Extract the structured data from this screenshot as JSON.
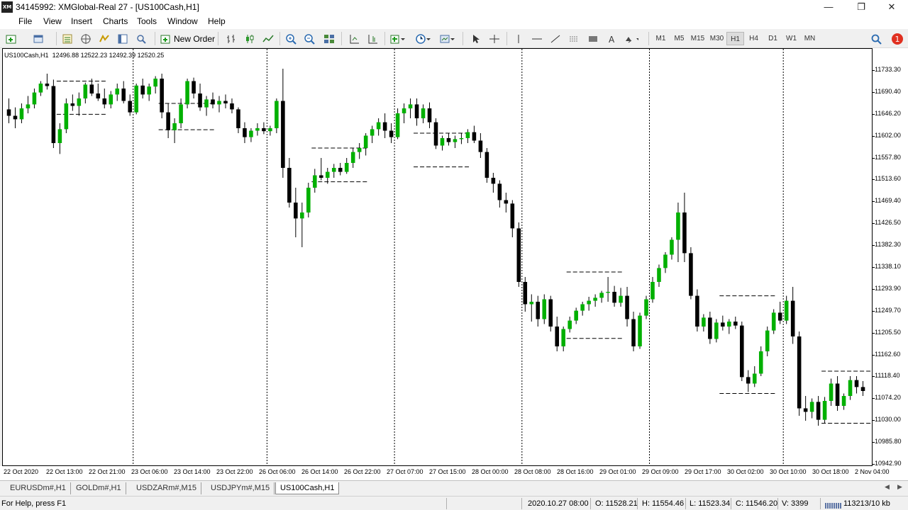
{
  "window": {
    "app_icon_text": "XM",
    "title": "34145992: XMGlobal-Real 27 - [US100Cash,H1]",
    "minimize_icon": "minimize-icon",
    "restore_icon": "restore-icon",
    "close_icon": "close-icon"
  },
  "menu": {
    "items": [
      "File",
      "View",
      "Insert",
      "Charts",
      "Tools",
      "Window",
      "Help"
    ]
  },
  "toolbar": {
    "new_order_label": "New Order",
    "timeframes": [
      "M1",
      "M5",
      "M15",
      "M30",
      "H1",
      "H4",
      "D1",
      "W1",
      "MN"
    ],
    "active_timeframe": "H1",
    "notification_count": "1",
    "icons": [
      "new-chart-icon",
      "profiles-icon",
      "market-watch-icon",
      "navigator-icon",
      "data-window-icon",
      "terminal-icon",
      "strategy-tester-icon",
      "new-order-icon",
      "bar-chart-icon",
      "candlestick-icon",
      "line-chart-icon",
      "zoom-in-icon",
      "zoom-out-icon",
      "tile-windows-icon",
      "autoscroll-icon",
      "chart-shift-icon",
      "indicators-icon",
      "periods-icon",
      "templates-icon",
      "cursor-icon",
      "crosshair-icon",
      "vertical-line-icon",
      "horizontal-line-icon",
      "trendline-icon",
      "channel-icon",
      "rectangle-icon",
      "text-icon",
      "arrows-icon",
      "search-icon",
      "notifications-icon"
    ]
  },
  "chart_header": {
    "symbol": "US100Cash,H1",
    "ohlc": "12496.88 12522.23 12492.39 12520.25"
  },
  "chart_data": {
    "type": "candlestick",
    "symbol": "US100Cash",
    "timeframe": "H1",
    "price_ticks": [
      "11733.30",
      "11690.40",
      "11646.20",
      "11602.00",
      "11557.80",
      "11513.60",
      "11469.40",
      "11426.50",
      "11382.30",
      "11338.10",
      "11293.90",
      "11249.70",
      "11205.50",
      "11162.60",
      "11118.40",
      "11074.20",
      "11030.00",
      "10985.80",
      "10942.90"
    ],
    "time_ticks": [
      "22 Oct 2020",
      "22 Oct 13:00",
      "22 Oct 21:00",
      "23 Oct 06:00",
      "23 Oct 14:00",
      "23 Oct 22:00",
      "26 Oct 06:00",
      "26 Oct 14:00",
      "26 Oct 22:00",
      "27 Oct 07:00",
      "27 Oct 15:00",
      "28 Oct 00:00",
      "28 Oct 08:00",
      "28 Oct 16:00",
      "29 Oct 01:00",
      "29 Oct 09:00",
      "29 Oct 17:00",
      "30 Oct 02:00",
      "30 Oct 10:00",
      "30 Oct 18:00",
      "2 Nov 04:00"
    ],
    "ylim": [
      10920,
      11760
    ],
    "grid": "vertical dotted day separators",
    "candle_up_color": "#00b000",
    "candle_down_color": "#000000",
    "candles": [
      [
        11638,
        11660,
        11610,
        11625
      ],
      [
        11625,
        11642,
        11600,
        11618
      ],
      [
        11618,
        11650,
        11610,
        11640
      ],
      [
        11640,
        11665,
        11630,
        11648
      ],
      [
        11648,
        11680,
        11640,
        11672
      ],
      [
        11672,
        11695,
        11665,
        11690
      ],
      [
        11690,
        11710,
        11678,
        11685
      ],
      [
        11685,
        11698,
        11560,
        11570
      ],
      [
        11570,
        11610,
        11548,
        11598
      ],
      [
        11598,
        11660,
        11590,
        11650
      ],
      [
        11650,
        11668,
        11635,
        11645
      ],
      [
        11645,
        11672,
        11625,
        11660
      ],
      [
        11660,
        11692,
        11650,
        11688
      ],
      [
        11688,
        11700,
        11665,
        11670
      ],
      [
        11670,
        11690,
        11655,
        11660
      ],
      [
        11660,
        11680,
        11640,
        11648
      ],
      [
        11648,
        11675,
        11640,
        11668
      ],
      [
        11668,
        11690,
        11655,
        11680
      ],
      [
        11680,
        11695,
        11650,
        11655
      ],
      [
        11655,
        11668,
        11625,
        11632
      ],
      [
        11632,
        11690,
        11628,
        11686
      ],
      [
        11686,
        11700,
        11660,
        11668
      ],
      [
        11668,
        11690,
        11655,
        11684
      ],
      [
        11684,
        11705,
        11670,
        11700
      ],
      [
        11700,
        11710,
        11620,
        11632
      ],
      [
        11632,
        11650,
        11580,
        11596
      ],
      [
        11596,
        11620,
        11570,
        11610
      ],
      [
        11610,
        11660,
        11600,
        11648
      ],
      [
        11648,
        11700,
        11640,
        11695
      ],
      [
        11695,
        11702,
        11660,
        11670
      ],
      [
        11670,
        11690,
        11635,
        11642
      ],
      [
        11642,
        11665,
        11625,
        11658
      ],
      [
        11658,
        11672,
        11640,
        11648
      ],
      [
        11648,
        11665,
        11632,
        11655
      ],
      [
        11655,
        11668,
        11640,
        11650
      ],
      [
        11650,
        11660,
        11630,
        11638
      ],
      [
        11638,
        11642,
        11590,
        11600
      ],
      [
        11600,
        11612,
        11570,
        11582
      ],
      [
        11582,
        11600,
        11572,
        11595
      ],
      [
        11595,
        11610,
        11585,
        11600
      ],
      [
        11600,
        11612,
        11588,
        11594
      ],
      [
        11594,
        11605,
        11585,
        11600
      ],
      [
        11600,
        11660,
        11590,
        11655
      ],
      [
        11655,
        11720,
        11500,
        11520
      ],
      [
        11520,
        11540,
        11440,
        11450
      ],
      [
        11450,
        11480,
        11380,
        11418
      ],
      [
        11418,
        11450,
        11360,
        11430
      ],
      [
        11430,
        11490,
        11420,
        11480
      ],
      [
        11480,
        11518,
        11470,
        11505
      ],
      [
        11505,
        11540,
        11495,
        11500
      ],
      [
        11500,
        11520,
        11488,
        11512
      ],
      [
        11512,
        11528,
        11500,
        11520
      ],
      [
        11520,
        11530,
        11505,
        11512
      ],
      [
        11512,
        11540,
        11508,
        11530
      ],
      [
        11530,
        11560,
        11520,
        11552
      ],
      [
        11552,
        11570,
        11538,
        11560
      ],
      [
        11560,
        11590,
        11545,
        11585
      ],
      [
        11585,
        11605,
        11570,
        11598
      ],
      [
        11598,
        11620,
        11585,
        11612
      ],
      [
        11612,
        11630,
        11580,
        11595
      ],
      [
        11595,
        11610,
        11570,
        11582
      ],
      [
        11582,
        11640,
        11578,
        11630
      ],
      [
        11630,
        11650,
        11610,
        11640
      ],
      [
        11640,
        11660,
        11620,
        11648
      ],
      [
        11648,
        11660,
        11605,
        11620
      ],
      [
        11620,
        11648,
        11610,
        11640
      ],
      [
        11640,
        11652,
        11600,
        11612
      ],
      [
        11612,
        11620,
        11558,
        11565
      ],
      [
        11565,
        11585,
        11555,
        11580
      ],
      [
        11580,
        11590,
        11565,
        11572
      ],
      [
        11572,
        11585,
        11560,
        11578
      ],
      [
        11578,
        11590,
        11568,
        11580
      ],
      [
        11580,
        11598,
        11570,
        11592
      ],
      [
        11592,
        11605,
        11570,
        11575
      ],
      [
        11575,
        11590,
        11540,
        11552
      ],
      [
        11552,
        11560,
        11490,
        11500
      ],
      [
        11500,
        11510,
        11470,
        11488
      ],
      [
        11488,
        11495,
        11440,
        11455
      ],
      [
        11455,
        11470,
        11430,
        11448
      ],
      [
        11448,
        11455,
        11380,
        11398
      ],
      [
        11398,
        11410,
        11280,
        11290
      ],
      [
        11290,
        11300,
        11230,
        11245
      ],
      [
        11245,
        11265,
        11210,
        11250
      ],
      [
        11250,
        11262,
        11200,
        11215
      ],
      [
        11215,
        11265,
        11205,
        11255
      ],
      [
        11255,
        11262,
        11190,
        11200
      ],
      [
        11200,
        11220,
        11150,
        11160
      ],
      [
        11160,
        11200,
        11150,
        11195
      ],
      [
        11195,
        11220,
        11188,
        11212
      ],
      [
        11212,
        11238,
        11205,
        11232
      ],
      [
        11232,
        11250,
        11222,
        11245
      ],
      [
        11245,
        11260,
        11232,
        11252
      ],
      [
        11252,
        11265,
        11240,
        11258
      ],
      [
        11258,
        11272,
        11248,
        11268
      ],
      [
        11268,
        11300,
        11250,
        11270
      ],
      [
        11270,
        11282,
        11240,
        11248
      ],
      [
        11248,
        11278,
        11240,
        11262
      ],
      [
        11262,
        11280,
        11200,
        11215
      ],
      [
        11215,
        11230,
        11150,
        11160
      ],
      [
        11160,
        11228,
        11155,
        11222
      ],
      [
        11222,
        11262,
        11215,
        11255
      ],
      [
        11255,
        11300,
        11248,
        11290
      ],
      [
        11290,
        11325,
        11280,
        11318
      ],
      [
        11318,
        11350,
        11308,
        11345
      ],
      [
        11345,
        11380,
        11335,
        11375
      ],
      [
        11375,
        11450,
        11330,
        11430
      ],
      [
        11430,
        11470,
        11330,
        11348
      ],
      [
        11348,
        11360,
        11255,
        11262
      ],
      [
        11262,
        11275,
        11190,
        11200
      ],
      [
        11200,
        11225,
        11190,
        11218
      ],
      [
        11218,
        11230,
        11165,
        11175
      ],
      [
        11175,
        11215,
        11168,
        11208
      ],
      [
        11208,
        11222,
        11192,
        11200
      ],
      [
        11200,
        11215,
        11185,
        11210
      ],
      [
        11210,
        11220,
        11195,
        11202
      ],
      [
        11202,
        11210,
        11090,
        11098
      ],
      [
        11098,
        11112,
        11068,
        11085
      ],
      [
        11085,
        11120,
        11078,
        11105
      ],
      [
        11105,
        11160,
        11100,
        11150
      ],
      [
        11150,
        11200,
        11140,
        11192
      ],
      [
        11192,
        11235,
        11185,
        11228
      ],
      [
        11228,
        11250,
        11205,
        11212
      ],
      [
        11212,
        11262,
        11205,
        11252
      ],
      [
        11252,
        11280,
        11165,
        11180
      ],
      [
        11180,
        11190,
        11020,
        11035
      ],
      [
        11035,
        11060,
        11010,
        11028
      ],
      [
        11028,
        11055,
        11015,
        11048
      ],
      [
        11048,
        11060,
        11000,
        11012
      ],
      [
        11012,
        11058,
        11005,
        11050
      ],
      [
        11050,
        11095,
        11040,
        11085
      ],
      [
        11085,
        11100,
        11030,
        11040
      ],
      [
        11040,
        11065,
        11032,
        11060
      ],
      [
        11060,
        11100,
        11052,
        11092
      ],
      [
        11092,
        11100,
        11065,
        11078
      ],
      [
        11078,
        11090,
        11060,
        11070
      ]
    ],
    "range_boxes": [
      {
        "from_index": 8,
        "to_index": 15,
        "high": 11695,
        "low": 11628
      },
      {
        "from_index": 24,
        "to_index": 32,
        "high": 11650,
        "low": 11597
      },
      {
        "from_index": 48,
        "to_index": 56,
        "high": 11560,
        "low": 11492
      },
      {
        "from_index": 64,
        "to_index": 72,
        "high": 11590,
        "low": 11522
      },
      {
        "from_index": 88,
        "to_index": 96,
        "high": 11310,
        "low": 11176
      },
      {
        "from_index": 112,
        "to_index": 120,
        "high": 11262,
        "low": 11065
      },
      {
        "from_index": 128,
        "to_index": 135,
        "high": 11110,
        "low": 11005
      }
    ]
  },
  "tabs": [
    "EURUSDm#,H1",
    "GOLDm#,H1",
    "USDZARm#,M15",
    "USDJPYm#,M15",
    "US100Cash,H1"
  ],
  "active_tab": "US100Cash,H1",
  "status": {
    "help": "For Help, press F1",
    "datetime": "2020.10.27 08:00",
    "open": "O: 11528.21",
    "high": "H: 11554.46",
    "low": "L: 11523.34",
    "close": "C: 11546.20",
    "volume": "V: 3399",
    "traffic": "113213/10 kb"
  }
}
